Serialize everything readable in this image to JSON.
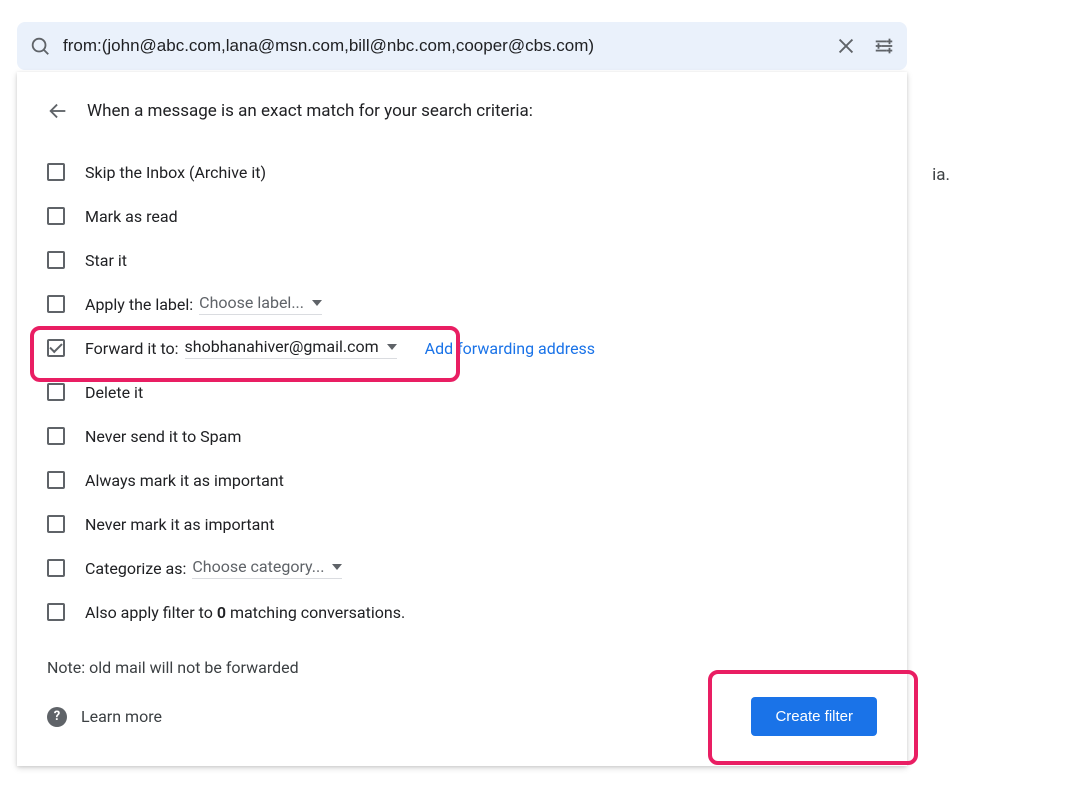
{
  "background_text": "ia.",
  "search": {
    "query": "from:(john@abc.com,lana@msn.com,bill@nbc.com,cooper@cbs.com)"
  },
  "header": "When a message is an exact match for your search criteria:",
  "options": {
    "skip_inbox": "Skip the Inbox (Archive it)",
    "mark_read": "Mark as read",
    "star_it": "Star it",
    "apply_label": "Apply the label:",
    "apply_label_value": "Choose label...",
    "forward_to": "Forward it to:",
    "forward_to_value": "shobhanahiver@gmail.com",
    "forward_link": "Add forwarding address",
    "delete_it": "Delete it",
    "never_spam": "Never send it to Spam",
    "always_important": "Always mark it as important",
    "never_important": "Never mark it as important",
    "categorize": "Categorize as:",
    "categorize_value": "Choose category...",
    "also_apply_pre": "Also apply filter to ",
    "also_apply_count": "0",
    "also_apply_post": " matching conversations."
  },
  "note": "Note: old mail will not be forwarded",
  "learn_more": "Learn more",
  "help_glyph": "?",
  "create_button": "Create filter"
}
